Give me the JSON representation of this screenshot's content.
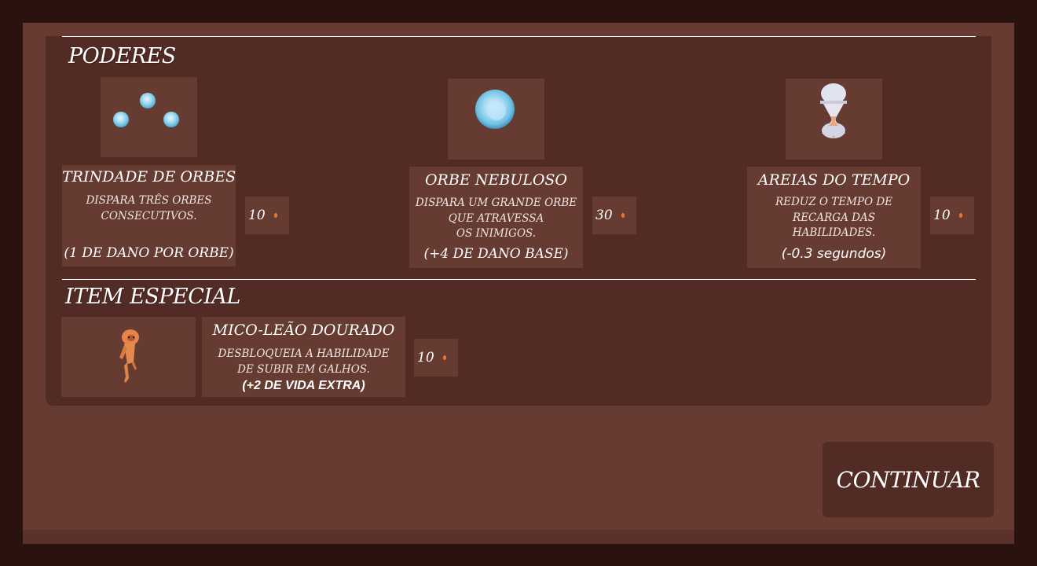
{
  "sections": {
    "powers_title": "PODERES",
    "special_title": "ITEM ESPECIAL"
  },
  "powers": [
    {
      "icon": "triple-orb-icon",
      "name": "TRINDADE DE ORBES",
      "desc": [
        "DISPARA TRÊS ORBES",
        "CONSECUTIVOS."
      ],
      "extra": "(1 DE DANO POR ORBE)",
      "price": "10"
    },
    {
      "icon": "nebula-orb-icon",
      "name": "ORBE NEBULOSO",
      "desc": [
        "DISPARA UM GRANDE ORBE",
        "QUE ATRAVESSA",
        "OS INIMIGOS."
      ],
      "extra": "(+4 DE DANO BASE)",
      "price": "30"
    },
    {
      "icon": "hourglass-icon",
      "name": "AREIAS DO TEMPO",
      "desc": [
        "REDUZ O TEMPO DE",
        "RECARGA DAS",
        "HABILIDADES."
      ],
      "extra": "(-0.3 segundos)",
      "price": "10"
    }
  ],
  "special_item": {
    "icon": "golden-lion-tamarin-icon",
    "name": "MICO-LEÃO DOURADO",
    "desc": [
      "DESBLOQUEIA A HABILIDADE",
      "DE SUBIR EM GALHOS."
    ],
    "extra": "(+2 DE VIDA EXTRA)",
    "price": "10"
  },
  "continue_label": "CONTINUAR",
  "colors": {
    "background": "#2a120e",
    "frame": "#673b32",
    "panel": "#532b25",
    "box": "#663b32",
    "coin": "#e8742a"
  }
}
